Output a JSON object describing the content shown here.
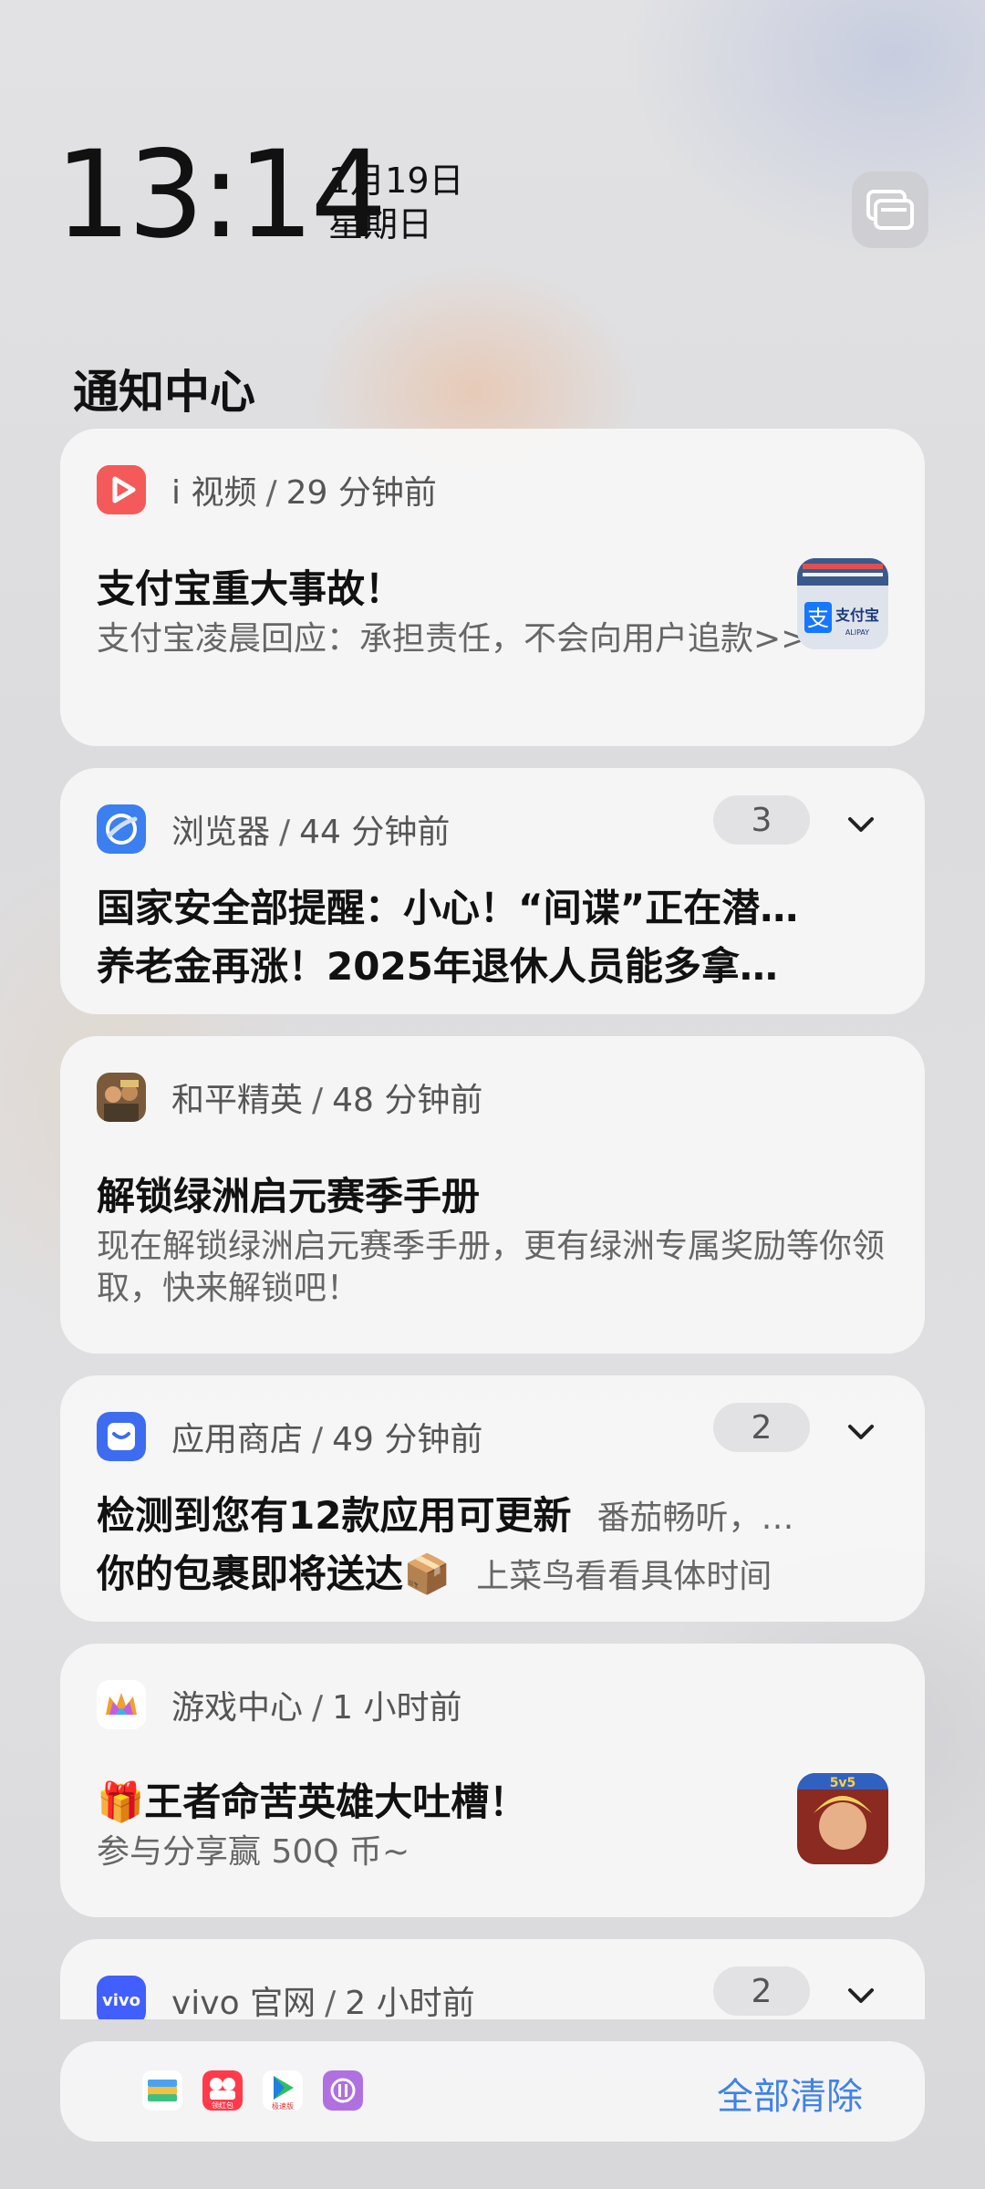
{
  "header": {
    "time": "13:14",
    "date": "1月19日",
    "weekday": "星期日",
    "icon": "stack-icon"
  },
  "title": "通知中心",
  "notifications": [
    {
      "app": "i 视频",
      "time": "29 分钟前",
      "title": "支付宝重大事故！",
      "body": "支付宝凌晨回应：承担责任，不会向用户追款>>",
      "icon": "ivideo-play-icon",
      "thumb_text": "支付宝",
      "thumb_sub": "ALIPAY"
    },
    {
      "app": "浏览器",
      "time": "44 分钟前",
      "count": "3",
      "lines": [
        "国家安全部提醒：小心！“间谍”正在潜…",
        "养老金再涨！2025年退休人员能多拿…"
      ],
      "icon": "browser-icon"
    },
    {
      "app": "和平精英",
      "time": "48 分钟前",
      "title": "解锁绿洲启元赛季手册",
      "body": "现在解锁绿洲启元赛季手册，更有绿洲专属奖励等你领取，快来解锁吧！",
      "icon": "game-avatar-icon"
    },
    {
      "app": "应用商店",
      "time": "49 分钟前",
      "count": "2",
      "lines": [
        {
          "title": "检测到您有12款应用可更新",
          "sub": "番茄畅听，…"
        },
        {
          "title": "你的包裹即将送达📦",
          "sub": "上菜鸟看看具体时间"
        }
      ],
      "icon": "app-store-icon"
    },
    {
      "app": "游戏中心",
      "time": "1 小时前",
      "title": "🎁王者命苦英雄大吐槽！",
      "body": "参与分享赢 50Q 币~",
      "icon": "crown-icon",
      "thumb_text": "5v5"
    },
    {
      "app": "vivo 官网",
      "time": "2 小时前",
      "count": "2",
      "icon_text": "vivo",
      "icon": "vivo-icon"
    }
  ],
  "bottom": {
    "clear_label": "全部清除",
    "icons": [
      "wallet-icon",
      "video-app-icon",
      "game-play-icon",
      "purple-app-icon"
    ],
    "mini_text_2": "领红包",
    "mini_text_3": "极速版"
  },
  "colors": {
    "accent": "#3f82e8",
    "ivideo": "#f45a5a",
    "browser": "#3b7ff0",
    "appstore": "#3d6cf0",
    "vivo": "#415fff"
  }
}
